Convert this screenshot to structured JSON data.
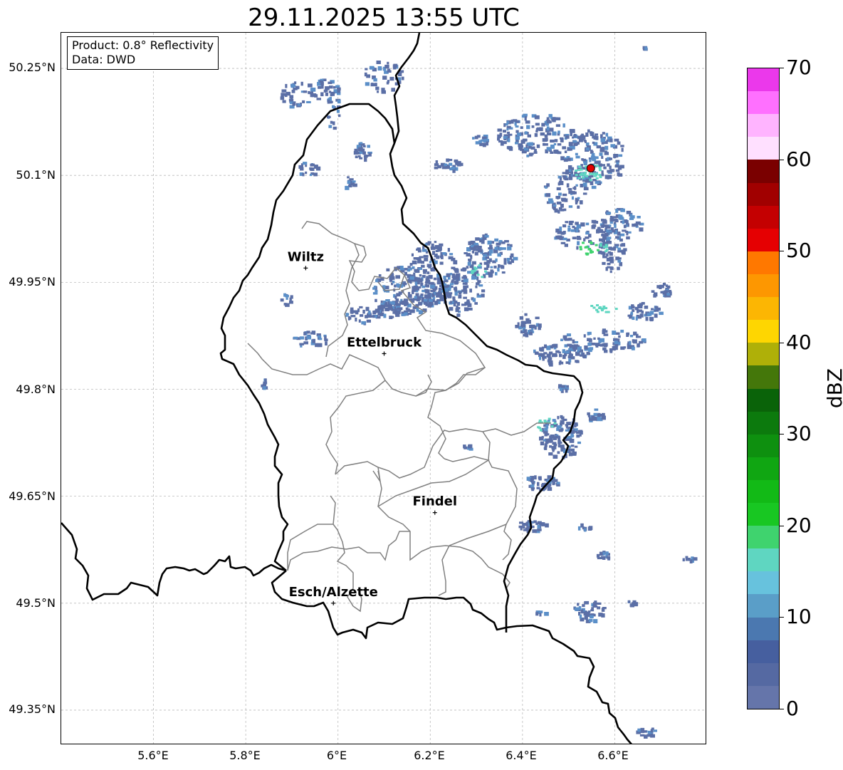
{
  "title": "29.11.2025 13:55 UTC",
  "info": {
    "product": "Product: 0.8° Reflectivity",
    "data": "Data: DWD"
  },
  "lat_labels": [
    "50.25°N",
    "50.1°N",
    "49.95°N",
    "49.8°N",
    "49.65°N",
    "49.5°N",
    "49.35°N"
  ],
  "lon_labels": [
    "5.6°E",
    "5.8°E",
    "6°E",
    "6.2°E",
    "6.4°E",
    "6.6°E"
  ],
  "cities": [
    {
      "name": "Wiltz",
      "lon": 5.93,
      "lat": 49.97
    },
    {
      "name": "Ettelbruck",
      "lon": 6.1,
      "lat": 49.85
    },
    {
      "name": "Findel",
      "lon": 6.21,
      "lat": 49.627
    },
    {
      "name": "Esch/Alzette",
      "lon": 5.99,
      "lat": 49.5
    }
  ],
  "radar_site": {
    "lon": 6.548,
    "lat": 50.11
  },
  "colorbar": {
    "unit": "dBZ",
    "min": 0,
    "max": 70,
    "tick_labels": [
      "0",
      "10",
      "20",
      "30",
      "40",
      "50",
      "60",
      "70"
    ],
    "colors": [
      "#6575aa",
      "#5569a2",
      "#465f9f",
      "#4b78b0",
      "#5a9ec8",
      "#67c2dd",
      "#5fd6c1",
      "#3fd36e",
      "#18c722",
      "#12ba16",
      "#10a612",
      "#0e900f",
      "#0c7a0d",
      "#0a6309",
      "#44770a",
      "#afb008",
      "#fed601",
      "#fcb603",
      "#fd9701",
      "#ff7800",
      "#e50002",
      "#c40001",
      "#a10000",
      "#7a0000",
      "#ffe0ff",
      "#ffb4ff",
      "#ff70ff",
      "#eb38eb"
    ]
  },
  "colors": {
    "echo_main": "#5b6fa6",
    "echo_light": "#5b8fc8",
    "echo_cyan": "#5fd6c1",
    "echo_green": "#3fd36e",
    "radar_marker": "#e00000",
    "country_border": "#000000",
    "canton_border": "#808080",
    "grid": "#bbbbbb"
  }
}
